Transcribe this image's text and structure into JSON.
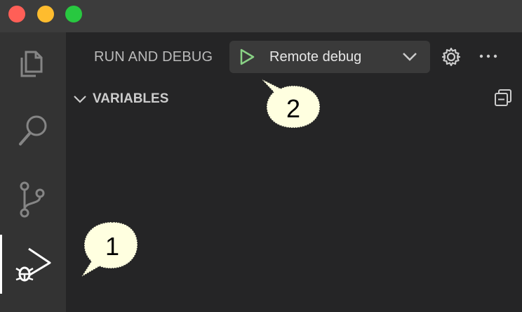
{
  "window": {
    "title": ""
  },
  "activity_bar": {
    "items": [
      {
        "name": "explorer",
        "icon": "files-icon"
      },
      {
        "name": "search",
        "icon": "search-icon"
      },
      {
        "name": "source-control",
        "icon": "source-control-icon"
      },
      {
        "name": "run-and-debug",
        "icon": "run-debug-icon",
        "active": true
      }
    ]
  },
  "sidebar": {
    "title": "RUN AND DEBUG",
    "config": {
      "selected": "Remote debug",
      "play_color": "#89d185"
    },
    "sections": [
      {
        "label": "VARIABLES",
        "expanded": true
      }
    ]
  },
  "callouts": [
    {
      "label": "1"
    },
    {
      "label": "2"
    }
  ]
}
